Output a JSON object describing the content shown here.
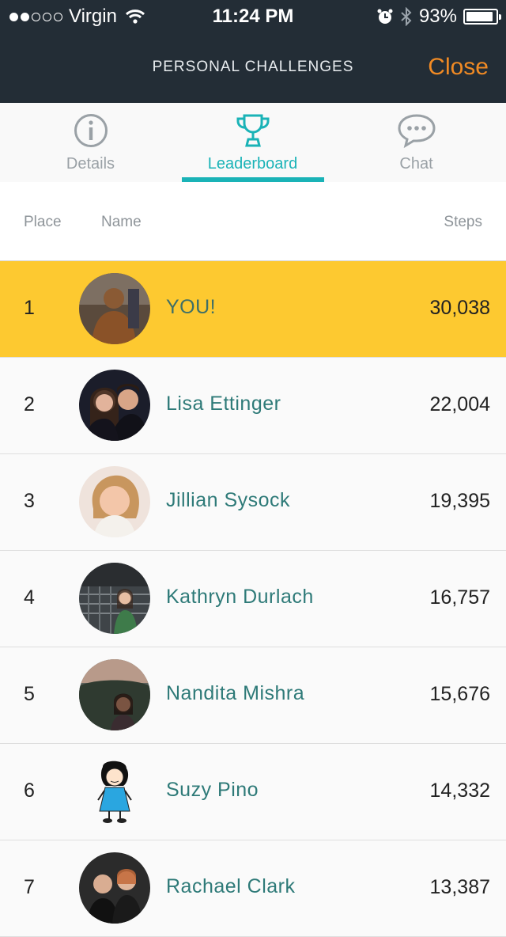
{
  "status_bar": {
    "signal_dots": [
      true,
      true,
      false,
      false,
      false
    ],
    "carrier": "Virgin",
    "time": "11:24 PM",
    "battery_level": 0.93,
    "battery_text": "93%"
  },
  "nav": {
    "title": "PERSONAL CHALLENGES",
    "close_label": "Close"
  },
  "tabs": [
    {
      "label": "Details",
      "icon": "info-icon",
      "active": false
    },
    {
      "label": "Leaderboard",
      "icon": "trophy-icon",
      "active": true
    },
    {
      "label": "Chat",
      "icon": "chat-bubble-icon",
      "active": false
    }
  ],
  "table": {
    "headers": {
      "place": "Place",
      "name": "Name",
      "steps": "Steps"
    },
    "rows": [
      {
        "place": "1",
        "name": "YOU!",
        "steps": "30,038",
        "highlight": true
      },
      {
        "place": "2",
        "name": "Lisa  Ettinger",
        "steps": "22,004",
        "highlight": false
      },
      {
        "place": "3",
        "name": "Jillian Sysock",
        "steps": "19,395",
        "highlight": false
      },
      {
        "place": "4",
        "name": "Kathryn Durlach",
        "steps": "16,757",
        "highlight": false
      },
      {
        "place": "5",
        "name": "Nandita Mishra",
        "steps": "15,676",
        "highlight": false
      },
      {
        "place": "6",
        "name": "Suzy Pino",
        "steps": "14,332",
        "highlight": false
      },
      {
        "place": "7",
        "name": "Rachael Clark",
        "steps": "13,387",
        "highlight": false
      }
    ]
  },
  "colors": {
    "nav_bg": "#232d36",
    "accent_orange": "#f08a24",
    "accent_teal": "#1ab3b7",
    "highlight_row": "#fdc930",
    "name_text": "#2e7a78"
  }
}
